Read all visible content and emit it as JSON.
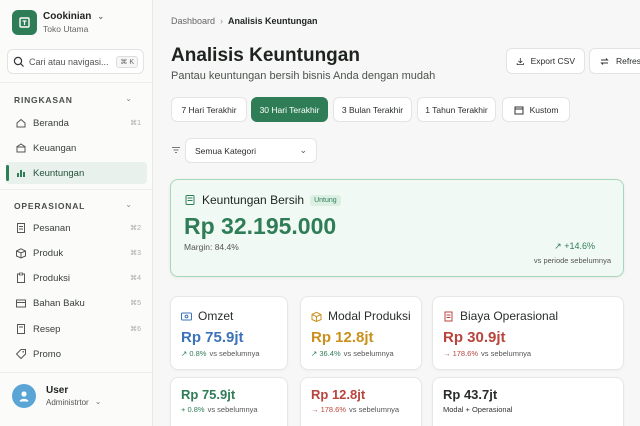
{
  "brand": {
    "name": "Cookinian",
    "subtitle": "Toko Utama"
  },
  "search": {
    "placeholder": "Cari atau navigasi...",
    "shortcut": "⌘ K"
  },
  "sidebar": {
    "sections": [
      {
        "title": "RINGKASAN",
        "items": [
          {
            "label": "Beranda",
            "shortcut": "⌘1",
            "icon": "home-icon"
          },
          {
            "label": "Keuangan",
            "shortcut": "",
            "icon": "wallet-icon"
          },
          {
            "label": "Keuntungan",
            "shortcut": "",
            "icon": "chart-bar-icon",
            "active": true
          }
        ]
      },
      {
        "title": "OPERASIONAL",
        "items": [
          {
            "label": "Pesanan",
            "shortcut": "⌘2",
            "icon": "receipt-icon"
          },
          {
            "label": "Produk",
            "shortcut": "⌘3",
            "icon": "box-icon"
          },
          {
            "label": "Produksi",
            "shortcut": "⌘4",
            "icon": "clipboard-icon"
          },
          {
            "label": "Bahan Baku",
            "shortcut": "⌘5",
            "icon": "package-icon"
          },
          {
            "label": "Resep",
            "shortcut": "⌘6",
            "icon": "book-icon"
          },
          {
            "label": "Promo",
            "shortcut": "",
            "icon": "tag-icon"
          }
        ]
      }
    ]
  },
  "user": {
    "name": "User",
    "role": "Administrtor"
  },
  "breadcrumb": {
    "root": "Dashboard",
    "current": "Analisis Keuntungan"
  },
  "page": {
    "title": "Analisis Keuntungan",
    "subtitle": "Pantau keuntungan bersih bisnis Anda dengan mudah"
  },
  "toolbar": {
    "export_label": "Export CSV",
    "refresh_label": "Refresh"
  },
  "periods": [
    {
      "label": "7 Hari Terakhir"
    },
    {
      "label": "30 Hari Terakhir",
      "active": true
    },
    {
      "label": "3 Bulan Terakhir"
    },
    {
      "label": "1 Tahun Terakhir"
    },
    {
      "label": "Kustom"
    }
  ],
  "filter": {
    "category": "Semua Kategori"
  },
  "net_profit": {
    "title": "Keuntungan Bersih",
    "badge": "Untung",
    "value": "Rp 32.195.000",
    "margin": "Margin: 84.4%",
    "trend": "↗ +14.6%",
    "trend_label": "vs periode sebelumnya"
  },
  "metrics": [
    {
      "title": "Omzet",
      "value": "Rp 75.9jt",
      "delta": "↗ 0.8%",
      "delta_label": "vs sebelumnya",
      "color": "#3c73b8"
    },
    {
      "title": "Modal Produksi",
      "value": "Rp 12.8jt",
      "delta": "↗ 36.4%",
      "delta_label": "vs sebelumnya",
      "color": "#c9901c"
    },
    {
      "title": "Biaya Operasional",
      "value": "Rp 30.9jt",
      "delta": "→ 178.6%",
      "delta_label": "vs sebelumnya",
      "color": "#b8443c"
    }
  ],
  "metrics_row2": [
    {
      "value": "Rp 75.9jt",
      "delta": "+ 0.8%",
      "delta_label": "vs sebelumnya",
      "color": "#2f7d57"
    },
    {
      "value": "Rp 12.8jt",
      "delta": "→ 178.6%",
      "delta_label": "vs sebelumnya",
      "color": "#b8443c"
    },
    {
      "value": "Rp 43.7jt",
      "delta": "Modal + Operasional",
      "delta_label": "",
      "color": "#2a2e2b"
    }
  ],
  "colors": {
    "accent": "#2f7d57",
    "positive": "#2f7d57",
    "negative": "#b8443c"
  }
}
